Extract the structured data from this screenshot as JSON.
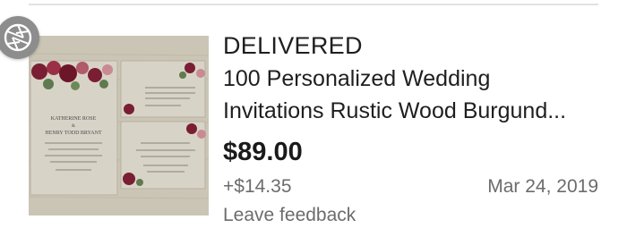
{
  "order": {
    "status": "DELIVERED",
    "title_line1": "100 Personalized Wedding",
    "title_line2": "Invitations Rustic Wood Burgund...",
    "price": "$89.00",
    "shipping": "+$14.35",
    "date": "Mar 24, 2019",
    "feedback_link": "Leave feedback"
  },
  "thumbnail": {
    "icon": "camera-shutter-icon",
    "main_card_lines": [
      "KATHERINE ROSE",
      "&",
      "HENRY TODD BRYANT"
    ]
  },
  "colors": {
    "text": "#1f1f1f",
    "muted": "#6c6c6c",
    "burgundy": "#7a1e33"
  }
}
